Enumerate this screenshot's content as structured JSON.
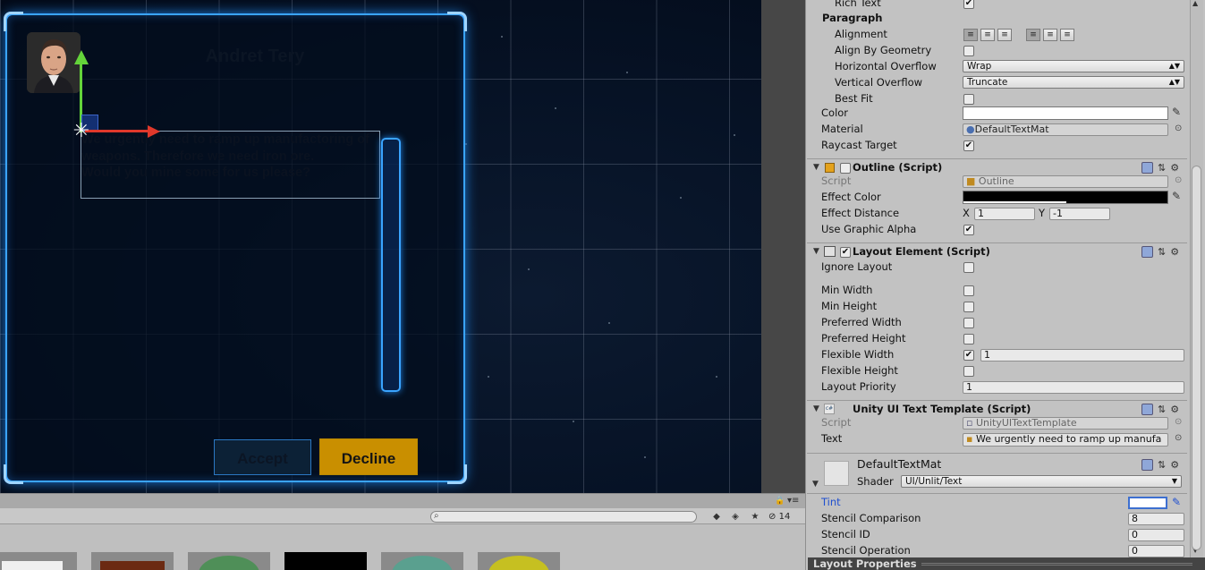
{
  "scene": {
    "npc_name": "Andret Tery",
    "dialog_text": "We urgently need to ramp up manufactoring of weapons. Therefore we need iron ore.\nWould you mine some for us please?",
    "accept_label": "Accept",
    "decline_label": "Decline"
  },
  "project": {
    "search_placeholder": "",
    "hidden_count": "14"
  },
  "inspector": {
    "rich_text_label": "Rich Text",
    "paragraph_header": "Paragraph",
    "alignment_label": "Alignment",
    "align_by_geometry_label": "Align By Geometry",
    "horizontal_overflow_label": "Horizontal Overflow",
    "horizontal_overflow_value": "Wrap",
    "vertical_overflow_label": "Vertical Overflow",
    "vertical_overflow_value": "Truncate",
    "best_fit_label": "Best Fit",
    "color_label": "Color",
    "material_label": "Material",
    "material_value": "DefaultTextMat",
    "raycast_target_label": "Raycast Target",
    "outline": {
      "title": "Outline (Script)",
      "script_label": "Script",
      "script_value": "Outline",
      "effect_color_label": "Effect Color",
      "effect_distance_label": "Effect Distance",
      "x_label": "X",
      "x_value": "1",
      "y_label": "Y",
      "y_value": "-1",
      "use_graphic_alpha_label": "Use Graphic Alpha"
    },
    "layout_element": {
      "title": "Layout Element (Script)",
      "ignore_layout_label": "Ignore Layout",
      "min_width_label": "Min Width",
      "min_height_label": "Min Height",
      "preferred_width_label": "Preferred Width",
      "preferred_height_label": "Preferred Height",
      "flexible_width_label": "Flexible Width",
      "flexible_width_value": "1",
      "flexible_height_label": "Flexible Height",
      "layout_priority_label": "Layout Priority",
      "layout_priority_value": "1"
    },
    "text_template": {
      "title": "Unity UI Text Template (Script)",
      "script_label": "Script",
      "script_value": "UnityUITextTemplate",
      "text_label": "Text",
      "text_value": "We urgently need to ramp up manufa"
    },
    "material_section": {
      "name": "DefaultTextMat",
      "shader_label": "Shader",
      "shader_value": "UI/Unlit/Text",
      "tint_label": "Tint",
      "stencil_comparison_label": "Stencil Comparison",
      "stencil_comparison_value": "8",
      "stencil_id_label": "Stencil ID",
      "stencil_id_value": "0",
      "stencil_operation_label": "Stencil Operation",
      "stencil_operation_value": "0"
    },
    "layout_properties_label": "Layout Properties"
  },
  "colors": {
    "panel_glow": "#3aa4ff",
    "decline_button": "#c98f00",
    "tint_label": "#1f4fd0"
  }
}
